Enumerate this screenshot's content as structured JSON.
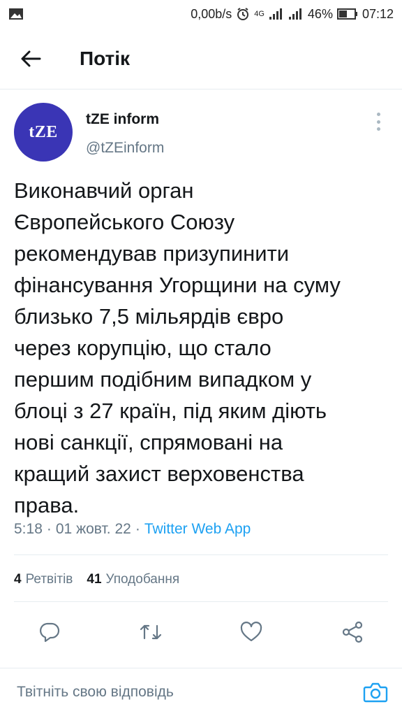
{
  "status_bar": {
    "net_speed": "0,00b/s",
    "network": "4G",
    "battery": "46%",
    "time": "07:12"
  },
  "header": {
    "back_icon": "arrow-left-icon",
    "title": "Потік"
  },
  "tweet": {
    "avatar_text": "tZE",
    "author_name": "tZE inform",
    "author_handle": "@tZEinform",
    "text": "Виконавчий орган\nЄвропейського Союзу\nрекомендував призупинити\nфінансування Угорщини на суму\nблизько 7,5 мільярдів євро\nчерез корупцію, що стало\nпершим подібним випадком у\nблоці з 27 країн, під яким діють\nнові санкції, спрямовані на\nкращий захист верховенства\nправа.",
    "time": "5:18",
    "separator": "·",
    "date": "01 жовт. 22",
    "source_app": "Twitter Web App",
    "retweets_count": "4",
    "retweets_label": "Ретвітів",
    "likes_count": "41",
    "likes_label": "Уподобання"
  },
  "actions": [
    "reply-icon",
    "retweet-icon",
    "like-icon",
    "share-icon"
  ],
  "reply_bar": {
    "placeholder": "Твітніть свою відповідь",
    "camera_icon": "camera-icon"
  },
  "colors": {
    "accent": "#1da1f2",
    "avatar_bg": "#3a35b5",
    "secondary_text": "#657786",
    "divider": "#e6ecf0"
  }
}
